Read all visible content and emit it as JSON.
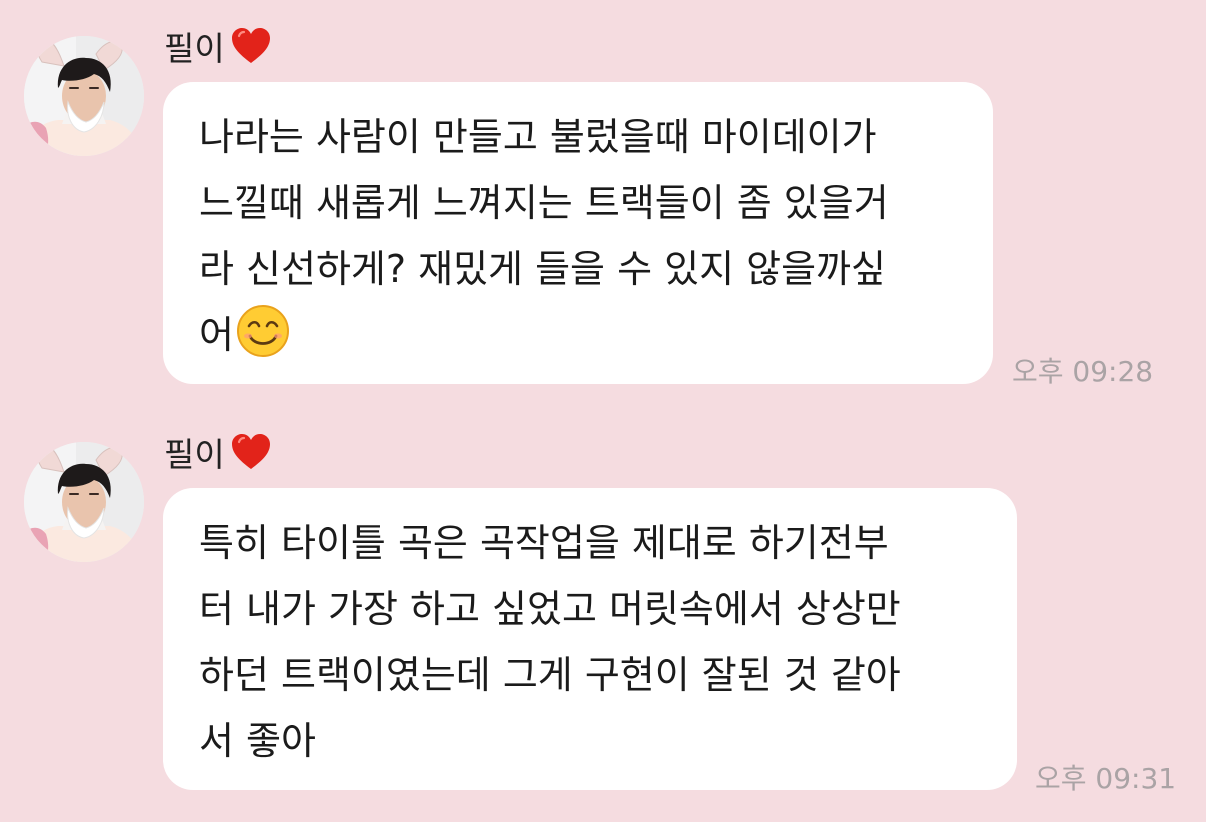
{
  "messages": [
    {
      "sender": "필이",
      "sender_badge_icon": "red-heart-icon",
      "lines": [
        "나라는 사람이 만들고 불렀을때 마이데이가",
        "느낄때 새롭게 느껴지는 트랙들이 좀 있을거",
        "라 신선하게? 재밌게 들을 수 있지 않을까싶",
        "어"
      ],
      "trailing_emoji": "smiling-face-icon",
      "time": "오후 09:28"
    },
    {
      "sender": "필이",
      "sender_badge_icon": "red-heart-icon",
      "lines": [
        "특히 타이틀 곡은 곡작업을 제대로 하기전부",
        "터 내가 가장 하고 싶었고 머릿속에서 상상만",
        "하던 트랙이였는데 그게 구현이 잘된 것 같아",
        "서 좋아"
      ],
      "time": "오후 09:31"
    }
  ],
  "colors": {
    "background": "#f5dce0",
    "bubble": "#ffffff",
    "text": "#1b1b1b",
    "timestamp": "#aaa3a5",
    "heart": "#e2231a"
  }
}
